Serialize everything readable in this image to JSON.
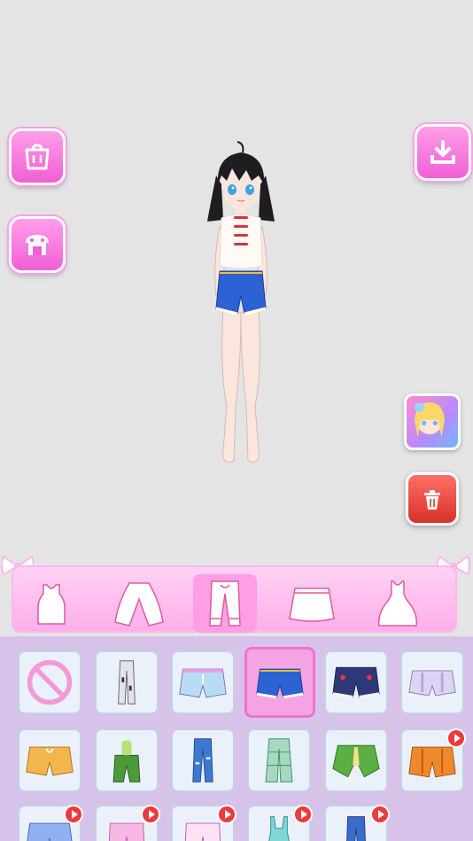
{
  "app": {
    "name": "dress-up-game"
  },
  "side_buttons": {
    "shop": {
      "icon": "shop-icon"
    },
    "wardrobe": {
      "icon": "wardrobe-icon"
    },
    "download": {
      "icon": "download-icon"
    },
    "promo_app": {
      "icon": "anime-girl-app-icon"
    },
    "delete": {
      "icon": "trash-icon"
    }
  },
  "categories": [
    {
      "id": "tops",
      "icon": "tank-top-icon",
      "active": false
    },
    {
      "id": "outerwear",
      "icon": "cardigan-icon",
      "active": false
    },
    {
      "id": "pants",
      "icon": "pants-icon",
      "active": true
    },
    {
      "id": "skirts",
      "icon": "skirt-icon",
      "active": false
    },
    {
      "id": "dresses",
      "icon": "dress-icon",
      "active": false
    }
  ],
  "items": [
    {
      "id": "none",
      "icon": "none-icon",
      "selected": false,
      "ad": false
    },
    {
      "id": "grey-joggers",
      "icon": "joggers-icon",
      "selected": false,
      "ad": false
    },
    {
      "id": "striped-shorts",
      "icon": "shorts-icon",
      "selected": false,
      "ad": false
    },
    {
      "id": "denim-shorts",
      "icon": "shorts-icon",
      "selected": true,
      "ad": false
    },
    {
      "id": "navy-lace-shorts",
      "icon": "shorts-icon",
      "selected": false,
      "ad": false
    },
    {
      "id": "lavender-bloomers",
      "icon": "bloomers-icon",
      "selected": false,
      "ad": false
    },
    {
      "id": "orange-shorts",
      "icon": "shorts-icon",
      "selected": false,
      "ad": false
    },
    {
      "id": "green-bag-pants",
      "icon": "pants-icon",
      "selected": false,
      "ad": false
    },
    {
      "id": "ripped-jeans",
      "icon": "jeans-icon",
      "selected": false,
      "ad": false
    },
    {
      "id": "plaid-wide-pants",
      "icon": "wide-pants-icon",
      "selected": false,
      "ad": false
    },
    {
      "id": "leaf-skort",
      "icon": "skort-icon",
      "selected": false,
      "ad": false
    },
    {
      "id": "pumpkin-shorts",
      "icon": "shorts-icon",
      "selected": false,
      "ad": true
    },
    {
      "id": "cloud-shorts",
      "icon": "shorts-icon",
      "selected": false,
      "ad": true
    },
    {
      "id": "pink-pants",
      "icon": "pants-icon",
      "selected": false,
      "ad": true
    },
    {
      "id": "white-pants",
      "icon": "pants-icon",
      "selected": false,
      "ad": true
    },
    {
      "id": "teal-overalls",
      "icon": "overalls-icon",
      "selected": false,
      "ad": true
    },
    {
      "id": "blue-jeans",
      "icon": "jeans-icon",
      "selected": false,
      "ad": true
    }
  ],
  "colors": {
    "accent_pink": "#f05fd6",
    "category_bar": "#ffb6ec",
    "grid_bg": "#d7c3ea",
    "delete_red": "#d8322a"
  }
}
